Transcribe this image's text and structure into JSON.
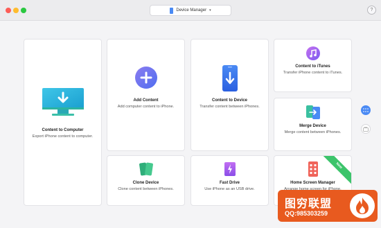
{
  "titlebar": {
    "device_selector": "Device Manager",
    "help": "?"
  },
  "cards": {
    "content_to_computer": {
      "title": "Content to Computer",
      "desc": "Export iPhone content to computer."
    },
    "add_content": {
      "title": "Add Content",
      "desc": "Add computer content to iPhone."
    },
    "content_to_device": {
      "title": "Content to Device",
      "desc": "Transfer content between iPhones."
    },
    "content_to_itunes": {
      "title": "Content to iTunes",
      "desc": "Transfer iPhone content to iTunes."
    },
    "merge_device": {
      "title": "Merge Device",
      "desc": "Merge content between iPhones."
    },
    "clone_device": {
      "title": "Clone Device",
      "desc": "Clone content between iPhones."
    },
    "fast_drive": {
      "title": "Fast Drive",
      "desc": "Use iPhone as an USB drive."
    },
    "home_screen_manager": {
      "title": "Home Screen Manager",
      "desc": "Arrange home screen for iPhone.",
      "badge": "New"
    }
  },
  "watermark": {
    "title": "图穷联盟",
    "qq": "QQ:985303259"
  },
  "colors": {
    "accent": "#4a8af4",
    "new_badge": "#3cc46b",
    "watermark": "#e85a1f"
  }
}
